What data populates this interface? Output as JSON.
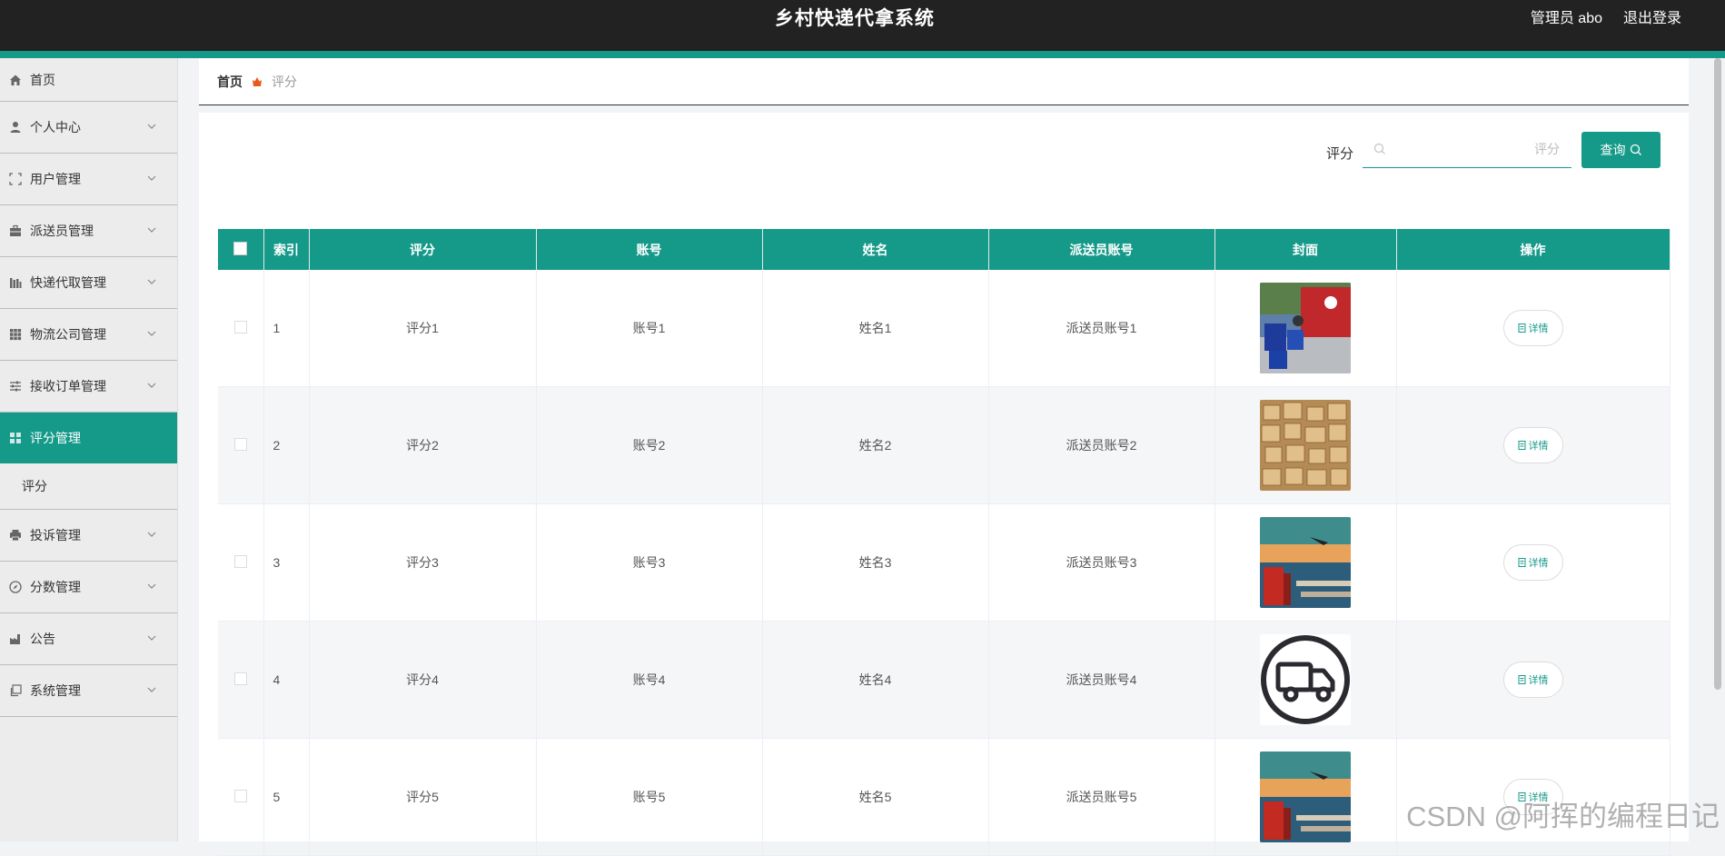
{
  "header": {
    "title": "乡村快递代拿系统",
    "user": "管理员 abo",
    "logout": "退出登录"
  },
  "sidebar": {
    "items": [
      {
        "label": "首页",
        "icon": "home-icon"
      },
      {
        "label": "个人中心",
        "icon": "user-icon"
      },
      {
        "label": "用户管理",
        "icon": "frame-icon"
      },
      {
        "label": "派送员管理",
        "icon": "briefcase-icon"
      },
      {
        "label": "快递代取管理",
        "icon": "chart-icon"
      },
      {
        "label": "物流公司管理",
        "icon": "grid-icon"
      },
      {
        "label": "接收订单管理",
        "icon": "sliders-icon"
      },
      {
        "label": "评分管理",
        "icon": "apps-icon"
      },
      {
        "label": "投诉管理",
        "icon": "printer-icon"
      },
      {
        "label": "分数管理",
        "icon": "compass-icon"
      },
      {
        "label": "公告",
        "icon": "factory-icon"
      },
      {
        "label": "系统管理",
        "icon": "copy-icon"
      }
    ],
    "active_sub": "评分"
  },
  "breadcrumb": {
    "home": "首页",
    "current": "评分"
  },
  "search": {
    "label": "评分",
    "placeholder": "评分",
    "button": "查询"
  },
  "table": {
    "columns": [
      "索引",
      "评分",
      "账号",
      "姓名",
      "派送员账号",
      "封面",
      "操作"
    ],
    "rows": [
      {
        "index": "1",
        "score": "评分1",
        "account": "账号1",
        "name": "姓名1",
        "courier": "派送员账号1",
        "cover": "cover-delivery-truck-photo"
      },
      {
        "index": "2",
        "score": "评分2",
        "account": "账号2",
        "name": "姓名2",
        "courier": "派送员账号2",
        "cover": "cover-boxes-photo"
      },
      {
        "index": "3",
        "score": "评分3",
        "account": "账号3",
        "name": "姓名3",
        "courier": "派送员账号3",
        "cover": "cover-logistics-photo"
      },
      {
        "index": "4",
        "score": "评分4",
        "account": "账号4",
        "name": "姓名4",
        "courier": "派送员账号4",
        "cover": "cover-truck-icon"
      },
      {
        "index": "5",
        "score": "评分5",
        "account": "账号5",
        "name": "姓名5",
        "courier": "派送员账号5",
        "cover": "cover-logistics-photo"
      }
    ],
    "detail_label": "详情"
  },
  "watermark": "CSDN @阿挥的编程日记",
  "colors": {
    "accent": "#159a8a",
    "header_bg": "#222222"
  }
}
